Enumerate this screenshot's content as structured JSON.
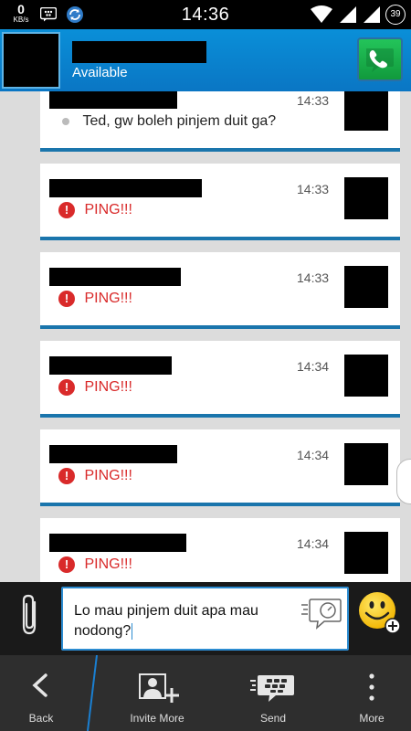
{
  "status_bar": {
    "data_speed": "0",
    "data_unit": "KB/s",
    "time": "14:36",
    "battery": "39"
  },
  "header": {
    "status": "Available"
  },
  "messages": [
    {
      "time": "14:33",
      "type": "text",
      "text": "Ted, gw boleh pinjem duit ga?"
    },
    {
      "time": "14:33",
      "type": "ping",
      "text": "PING!!!"
    },
    {
      "time": "14:33",
      "type": "ping",
      "text": "PING!!!"
    },
    {
      "time": "14:34",
      "type": "ping",
      "text": "PING!!!"
    },
    {
      "time": "14:34",
      "type": "ping",
      "text": "PING!!!"
    },
    {
      "time": "14:34",
      "type": "ping",
      "text": "PING!!!"
    }
  ],
  "composer": {
    "text": "Lo mau pinjem duit apa mau nodong?"
  },
  "actions": {
    "back": "Back",
    "invite_more": "Invite More",
    "send": "Send",
    "more": "More"
  },
  "colors": {
    "header_blue": "#0a8fd8",
    "card_underline": "#1a75ac",
    "ping_red": "#d92a2a",
    "call_green": "#1fb851"
  },
  "icons": [
    "bbm-icon",
    "sync-icon",
    "wifi-icon",
    "signal-icon",
    "battery-icon",
    "phone-icon",
    "alert-icon",
    "paperclip-icon",
    "timer-icon",
    "emoji-icon",
    "back-icon",
    "invite-icon",
    "send-icon",
    "more-icon"
  ]
}
